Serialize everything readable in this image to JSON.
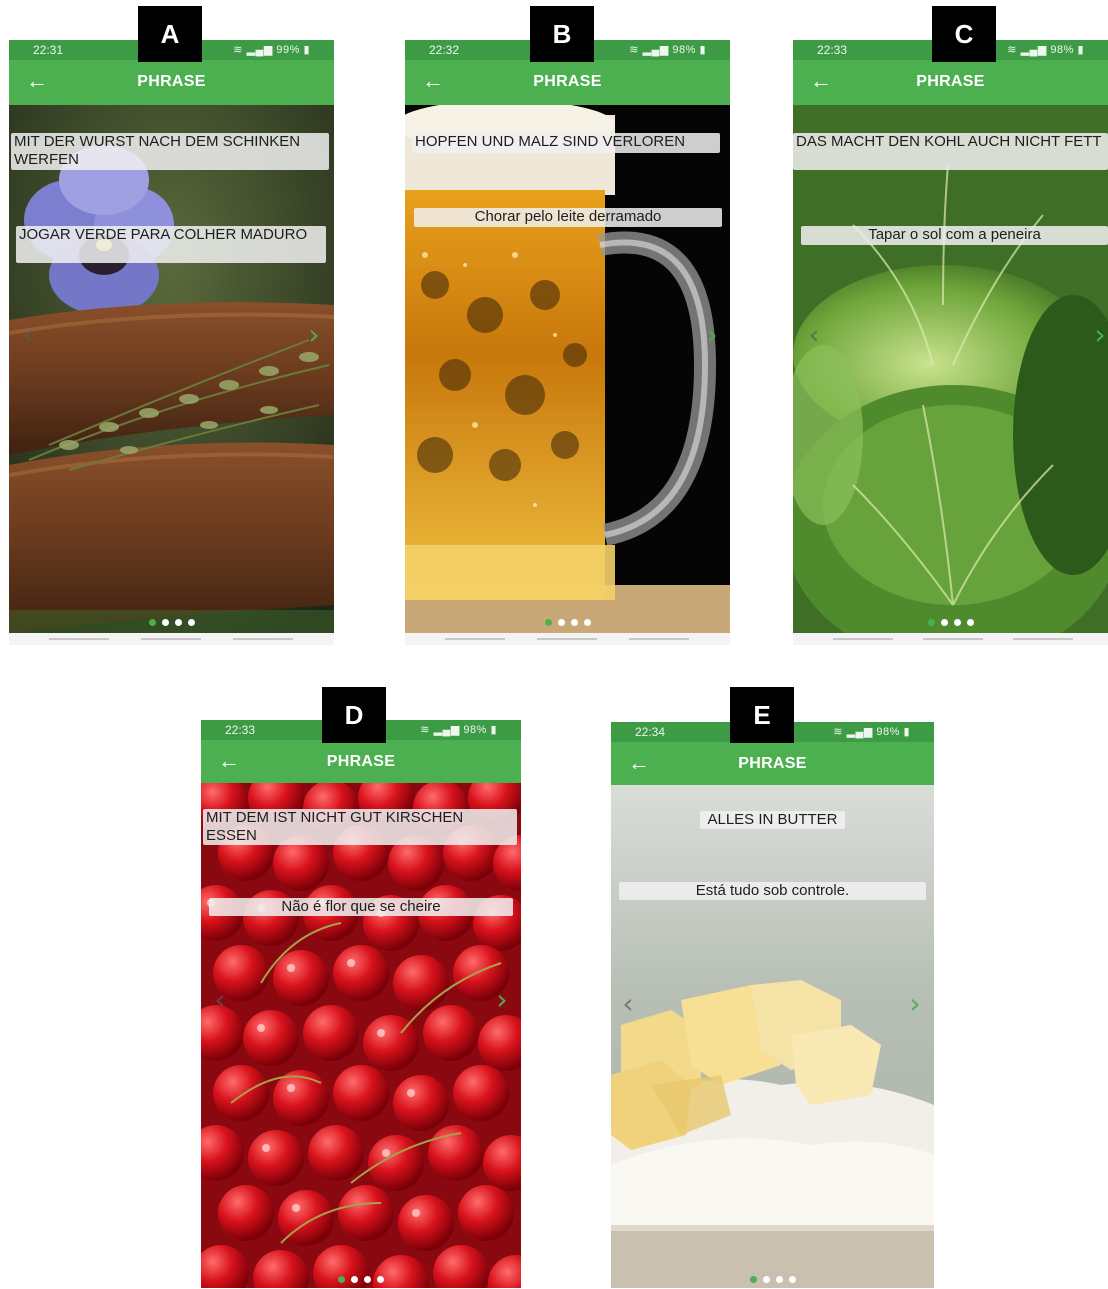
{
  "screens": [
    {
      "tag": "A",
      "status_time": "22:31",
      "battery": "99%",
      "appbar_title": "PHRASE",
      "german_phrase": "MIT DER WURST NACH DEM SCHINKEN WERFEN",
      "portuguese_phrase": "JOGAR VERDE PARA COLHER MADURO",
      "image": "sausages-with-thyme-and-pansy",
      "page_indicator": {
        "active": 1,
        "total": 4
      }
    },
    {
      "tag": "B",
      "status_time": "22:32",
      "battery": "98%",
      "appbar_title": "PHRASE",
      "german_phrase": "HOPFEN UND MALZ SIND VERLOREN",
      "portuguese_phrase": "Chorar pelo leite derramado",
      "image": "beer-mug",
      "page_indicator": {
        "active": 1,
        "total": 4
      }
    },
    {
      "tag": "C",
      "status_time": "22:33",
      "battery": "98%",
      "appbar_title": "PHRASE",
      "german_phrase": "DAS MACHT DEN KOHL AUCH NICHT FETT",
      "portuguese_phrase": "Tapar o sol com a peneira",
      "image": "cabbage",
      "page_indicator": {
        "active": 1,
        "total": 4
      }
    },
    {
      "tag": "D",
      "status_time": "22:33",
      "battery": "98%",
      "appbar_title": "PHRASE",
      "german_phrase": "MIT DEM IST NICHT GUT KIRSCHEN ESSEN",
      "portuguese_phrase": "Não é flor que se cheire",
      "image": "cherries",
      "page_indicator": {
        "active": 1,
        "total": 4
      }
    },
    {
      "tag": "E",
      "status_time": "22:34",
      "battery": "98%",
      "appbar_title": "PHRASE",
      "german_phrase": "ALLES IN BUTTER",
      "portuguese_phrase": "Está tudo sob controle.",
      "image": "butter-and-flour",
      "page_indicator": {
        "active": 1,
        "total": 4
      }
    }
  ],
  "icons": {
    "back": "arrow-left-icon",
    "next": "chevron-right-icon",
    "prev": "chevron-left-icon",
    "wifi": "wifi-icon",
    "signal": "signal-icon",
    "battery": "battery-icon"
  },
  "colors": {
    "app_bar": "#4cb050",
    "status_bar": "#3d9b45",
    "next_arrow": "#4cb050",
    "active_dot": "#4cb050"
  }
}
